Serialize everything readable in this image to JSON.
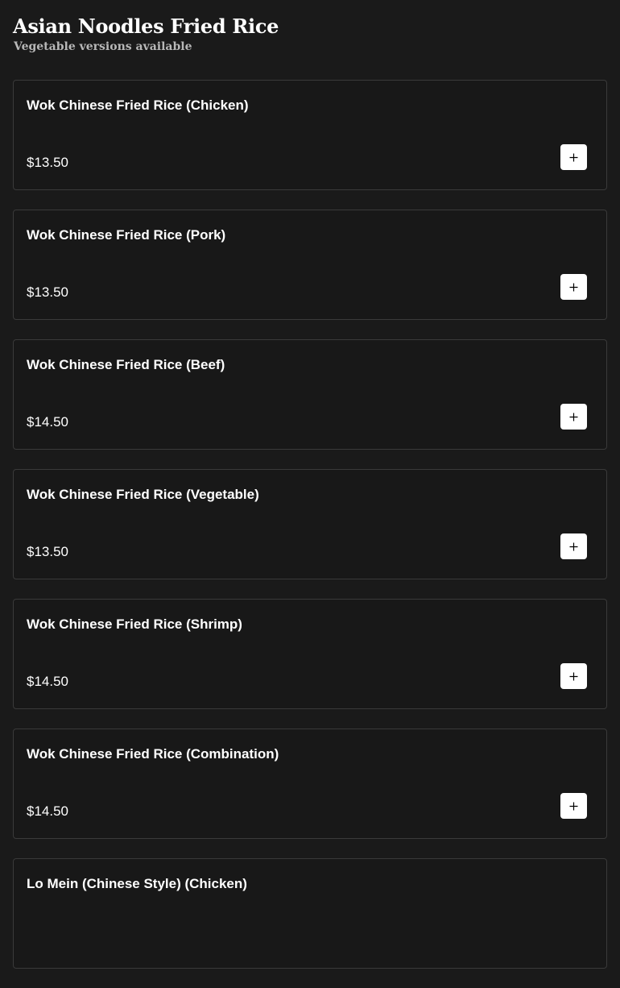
{
  "section": {
    "title": "Asian Noodles Fried Rice",
    "subtitle": "Vegetable versions available"
  },
  "items": [
    {
      "name": "Wok Chinese Fried Rice (Chicken)",
      "price": "$13.50"
    },
    {
      "name": "Wok Chinese Fried Rice (Pork)",
      "price": "$13.50"
    },
    {
      "name": "Wok Chinese Fried Rice (Beef)",
      "price": "$14.50"
    },
    {
      "name": "Wok Chinese Fried Rice (Vegetable)",
      "price": "$13.50"
    },
    {
      "name": "Wok Chinese Fried Rice (Shrimp)",
      "price": "$14.50"
    },
    {
      "name": "Wok Chinese Fried Rice (Combination)",
      "price": "$14.50"
    },
    {
      "name": "Lo Mein (Chinese Style) (Chicken)",
      "price": ""
    }
  ],
  "icons": {
    "add": "plus-icon"
  },
  "colors": {
    "background": "#1a1a1a",
    "card_border": "#3a3a3a",
    "button": "#ffffff",
    "subtitle": "#b8b8b8"
  }
}
